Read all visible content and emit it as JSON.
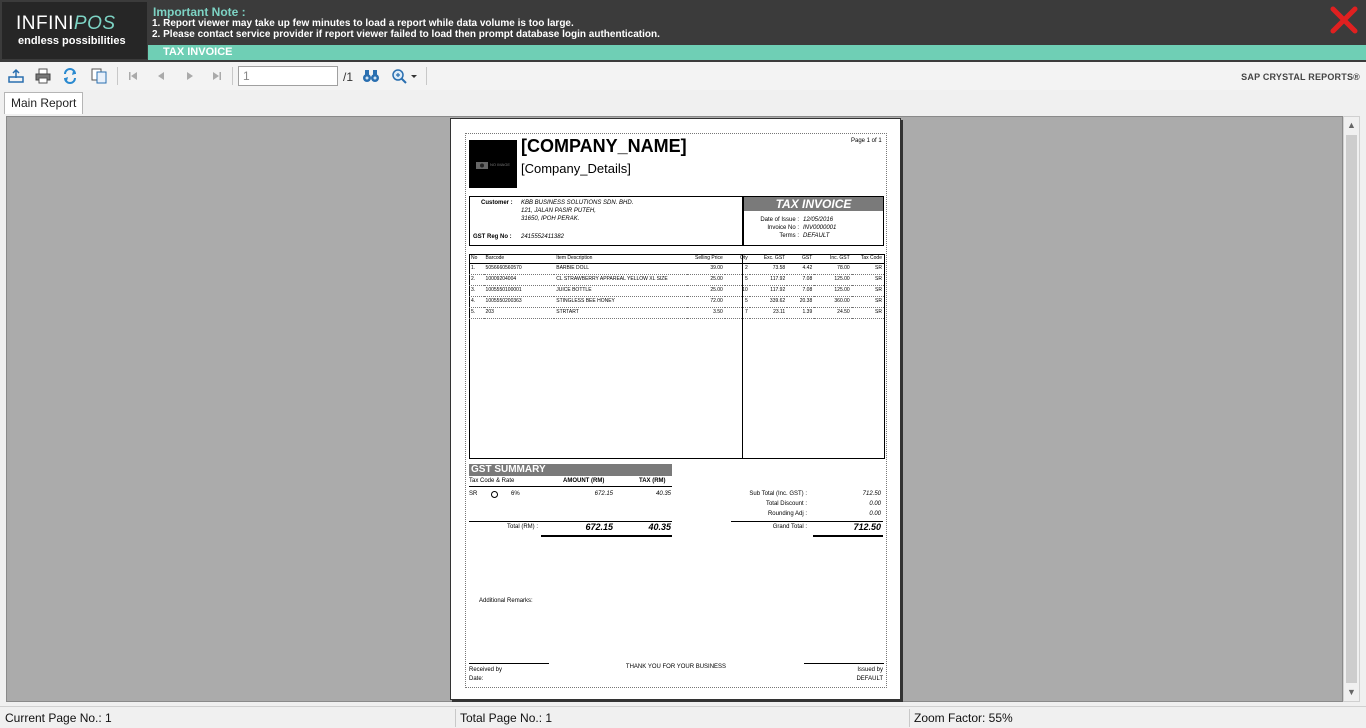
{
  "banner": {
    "logo_main": "INFINI",
    "logo_pos": "POS",
    "logo_tagline": "endless possibilities",
    "note_title": "Important Note :",
    "note_lines": [
      "1. Report viewer may take up few minutes to load a report while data volume is too large.",
      "2. Please contact service provider if report viewer failed to load then prompt database login authentication."
    ],
    "subtitle": "TAX INVOICE"
  },
  "toolbar": {
    "page_value": "1",
    "page_total": "/1",
    "brand": "SAP CRYSTAL REPORTS®"
  },
  "tabs": [
    {
      "label": "Main Report"
    }
  ],
  "report": {
    "page_of": "Page 1 of 1",
    "no_image": "NO IMAGE",
    "company_name": "[COMPANY_NAME]",
    "company_details": "[Company_Details]",
    "customer_label": "Customer :",
    "customer_lines": [
      "KBB BUSINESS SOLUTIONS SDN. BHD.",
      "121, JALAN PASIR PUTEH,",
      "31650, IPOH PERAK."
    ],
    "gst_reg_label": "GST Reg No :",
    "gst_reg_value": "2415552411382",
    "invoice_title": "TAX INVOICE",
    "date_label": "Date of Issue :",
    "date_value": "12/05/2016",
    "invoice_no_label": "Invoice No :",
    "invoice_no_value": "INV0000001",
    "terms_label": "Terms :",
    "terms_value": "DEFAULT",
    "item_headers": [
      "No",
      "Barcode",
      "Item Description",
      "Selling Price",
      "Qty",
      "Exc. GST",
      "GST",
      "Inc. GST",
      "Tax Code"
    ],
    "items": [
      [
        "1.",
        "5056660560570",
        "BARBIE DOLL",
        "39.00",
        "2",
        "73.58",
        "4.42",
        "78.00",
        "SR"
      ],
      [
        "2.",
        "10009204004",
        "CL STRAWBERRY APPAREAL YELLOW XL SIZE",
        "25.00",
        "5",
        "117.92",
        "7.08",
        "125.00",
        "SR"
      ],
      [
        "3.",
        "1005550100001",
        "JUICE BOTTLE",
        "25.00",
        "10",
        "117.92",
        "7.08",
        "125.00",
        "SR"
      ],
      [
        "4.",
        "1005550200363",
        "STINGLESS BEE HONEY",
        "72.00",
        "5",
        "339.62",
        "20.38",
        "360.00",
        "SR"
      ],
      [
        "5.",
        "203",
        "STRTART",
        "3.50",
        "7",
        "23.11",
        "1.39",
        "24.50",
        "SR"
      ]
    ],
    "gst_summary_title": "GST SUMMARY",
    "gst_headers": [
      "Tax Code & Rate",
      "AMOUNT (RM)",
      "TAX (RM)"
    ],
    "gst_row": {
      "code": "SR",
      "rate": "6%",
      "amount": "672.15",
      "tax": "40.35"
    },
    "gst_total_label": "Total (RM) :",
    "gst_total_amount": "672.15",
    "gst_total_tax": "40.35",
    "subtotal_label": "Sub Total (Inc. GST) :",
    "subtotal_value": "712.50",
    "discount_label": "Total Discount :",
    "discount_value": "0.00",
    "rounding_label": "Rounding Adj :",
    "rounding_value": "0.00",
    "grand_total_label": "Grand Total :",
    "grand_total_value": "712.50",
    "remarks_label": "Additional Remarks:",
    "received_by": "Received by",
    "date_footer": "Date:",
    "thank_you": "THANK YOU FOR YOUR BUSINESS",
    "issued_by": "Issued by",
    "issued_value": "DEFAULT"
  },
  "status": {
    "current_page": "Current Page No.: 1",
    "total_page": "Total Page No.: 1",
    "zoom": "Zoom Factor: 55%"
  },
  "colors": {
    "accent": "#6fcfb5",
    "banner": "#3b3b3b",
    "close": "#e02020"
  }
}
